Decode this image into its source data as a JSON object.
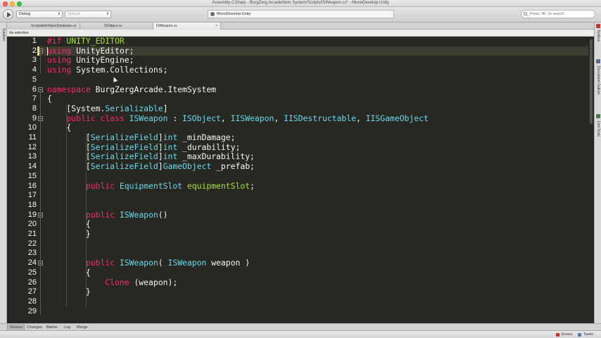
{
  "window": {
    "title": "Assembly-CSharp - BurgZerg Arcade/Item System/Scripts/ISWeapon.cs* - MonoDevelop-Unity"
  },
  "toolbar": {
    "config_value": "Debug",
    "platform_value": "Default",
    "status_text": "MonoDevelop-Unity",
    "search_placeholder": "Press '⌘.' to search"
  },
  "left_dock": {
    "label": "Solution"
  },
  "right_dock": {
    "labels": [
      "Toolbox",
      "Document Outline",
      "Unit Tests"
    ]
  },
  "tabs": [
    {
      "label": "ScriptableObjectDatabase.cs",
      "active": false
    },
    {
      "label": "ISObject.cs",
      "active": false
    },
    {
      "label": "ISWeapon.cs",
      "active": true
    }
  ],
  "tab_close_glyph": "×",
  "breadcrumb": "No selection",
  "editor": {
    "current_line": 2,
    "lines": [
      {
        "n": "1",
        "fold": false,
        "tokens": [
          {
            "t": "#if ",
            "c": "dir"
          },
          {
            "t": "UNITY_EDITOR",
            "c": "pp"
          }
        ]
      },
      {
        "n": "2",
        "fold": true,
        "tokens": [
          {
            "t": "using",
            "c": "kw"
          },
          {
            "t": " UnityEditor;",
            "c": ""
          }
        ]
      },
      {
        "n": "3",
        "fold": false,
        "tokens": [
          {
            "t": "using",
            "c": "kw"
          },
          {
            "t": " UnityEngine;",
            "c": ""
          }
        ]
      },
      {
        "n": "4",
        "fold": false,
        "tokens": [
          {
            "t": "using",
            "c": "kw"
          },
          {
            "t": " System.Collections;",
            "c": ""
          }
        ]
      },
      {
        "n": "5",
        "fold": false,
        "tokens": []
      },
      {
        "n": "6",
        "fold": true,
        "tokens": [
          {
            "t": "namespace",
            "c": "kw"
          },
          {
            "t": " BurgZergArcade.ItemSystem",
            "c": ""
          }
        ]
      },
      {
        "n": "7",
        "fold": false,
        "tokens": [
          {
            "t": "{",
            "c": ""
          }
        ]
      },
      {
        "n": "8",
        "fold": false,
        "tokens": [
          {
            "t": "    [System.",
            "c": ""
          },
          {
            "t": "Serializable",
            "c": "ty"
          },
          {
            "t": "]",
            "c": ""
          }
        ]
      },
      {
        "n": "9",
        "fold": true,
        "tokens": [
          {
            "t": "    ",
            "c": ""
          },
          {
            "t": "public class",
            "c": "kw"
          },
          {
            "t": " ",
            "c": ""
          },
          {
            "t": "ISWeapon",
            "c": "ty"
          },
          {
            "t": " : ",
            "c": ""
          },
          {
            "t": "ISObject",
            "c": "ty"
          },
          {
            "t": ", ",
            "c": ""
          },
          {
            "t": "IISWeapon",
            "c": "ty"
          },
          {
            "t": ", ",
            "c": ""
          },
          {
            "t": "IISDestructable",
            "c": "ty"
          },
          {
            "t": ", ",
            "c": ""
          },
          {
            "t": "IISGameObject",
            "c": "ty"
          }
        ]
      },
      {
        "n": "10",
        "fold": false,
        "tokens": [
          {
            "t": "    {",
            "c": ""
          }
        ]
      },
      {
        "n": "11",
        "fold": false,
        "tokens": [
          {
            "t": "        [",
            "c": ""
          },
          {
            "t": "SerializeField",
            "c": "ty"
          },
          {
            "t": "]",
            "c": ""
          },
          {
            "t": "int",
            "c": "ty"
          },
          {
            "t": " _minDamage;",
            "c": ""
          }
        ]
      },
      {
        "n": "12",
        "fold": false,
        "tokens": [
          {
            "t": "        [",
            "c": ""
          },
          {
            "t": "SerializeField",
            "c": "ty"
          },
          {
            "t": "]",
            "c": ""
          },
          {
            "t": "int",
            "c": "ty"
          },
          {
            "t": " _durability;",
            "c": ""
          }
        ]
      },
      {
        "n": "13",
        "fold": false,
        "tokens": [
          {
            "t": "        [",
            "c": ""
          },
          {
            "t": "SerializeField",
            "c": "ty"
          },
          {
            "t": "]",
            "c": ""
          },
          {
            "t": "int",
            "c": "ty"
          },
          {
            "t": " _maxDurability;",
            "c": ""
          }
        ]
      },
      {
        "n": "14",
        "fold": false,
        "tokens": [
          {
            "t": "        [",
            "c": ""
          },
          {
            "t": "SerializeField",
            "c": "ty"
          },
          {
            "t": "]",
            "c": ""
          },
          {
            "t": "GameObject",
            "c": "ty"
          },
          {
            "t": " _prefab;",
            "c": ""
          }
        ]
      },
      {
        "n": "15",
        "fold": false,
        "tokens": []
      },
      {
        "n": "16",
        "fold": false,
        "tokens": [
          {
            "t": "        ",
            "c": ""
          },
          {
            "t": "public",
            "c": "kw"
          },
          {
            "t": " ",
            "c": ""
          },
          {
            "t": "EquipmentSlot",
            "c": "ty"
          },
          {
            "t": " ",
            "c": ""
          },
          {
            "t": "equipmentSlot",
            "c": "fn"
          },
          {
            "t": ";",
            "c": ""
          }
        ]
      },
      {
        "n": "17",
        "fold": false,
        "tokens": []
      },
      {
        "n": "18",
        "fold": false,
        "tokens": []
      },
      {
        "n": "19",
        "fold": true,
        "tokens": [
          {
            "t": "        ",
            "c": ""
          },
          {
            "t": "public",
            "c": "kw"
          },
          {
            "t": " ",
            "c": ""
          },
          {
            "t": "ISWeapon",
            "c": "ty"
          },
          {
            "t": "()",
            "c": ""
          }
        ]
      },
      {
        "n": "20",
        "fold": false,
        "tokens": [
          {
            "t": "        {",
            "c": ""
          }
        ]
      },
      {
        "n": "21",
        "fold": false,
        "tokens": [
          {
            "t": "        }",
            "c": ""
          }
        ]
      },
      {
        "n": "22",
        "fold": false,
        "tokens": []
      },
      {
        "n": "23",
        "fold": false,
        "tokens": []
      },
      {
        "n": "24",
        "fold": true,
        "tokens": [
          {
            "t": "        ",
            "c": ""
          },
          {
            "t": "public",
            "c": "kw"
          },
          {
            "t": " ",
            "c": ""
          },
          {
            "t": "ISWeapon",
            "c": "ty"
          },
          {
            "t": "( ",
            "c": ""
          },
          {
            "t": "ISWeapon",
            "c": "ty"
          },
          {
            "t": " weapon )",
            "c": ""
          }
        ]
      },
      {
        "n": "25",
        "fold": false,
        "tokens": [
          {
            "t": "        {",
            "c": ""
          }
        ]
      },
      {
        "n": "26",
        "fold": false,
        "tokens": [
          {
            "t": "            ",
            "c": ""
          },
          {
            "t": "Clone",
            "c": "kw"
          },
          {
            "t": " (weapon);",
            "c": ""
          }
        ]
      },
      {
        "n": "27",
        "fold": false,
        "tokens": [
          {
            "t": "        }",
            "c": ""
          }
        ]
      },
      {
        "n": "28",
        "fold": false,
        "tokens": []
      },
      {
        "n": "29",
        "fold": false,
        "tokens": []
      }
    ]
  },
  "bottom_tabs": [
    {
      "label": "Source",
      "active": true
    },
    {
      "label": "Changes",
      "active": false
    },
    {
      "label": "Blame",
      "active": false
    },
    {
      "label": "Log",
      "active": false
    },
    {
      "label": "Merge",
      "active": false
    }
  ],
  "statusbar": {
    "errors_label": "Errors",
    "tasks_label": "Tasks"
  },
  "colors": {
    "editor_bg": "#272822",
    "keyword": "#f92672",
    "type": "#66d9ef",
    "function": "#a6e22e",
    "plain": "#f8f8f2"
  }
}
